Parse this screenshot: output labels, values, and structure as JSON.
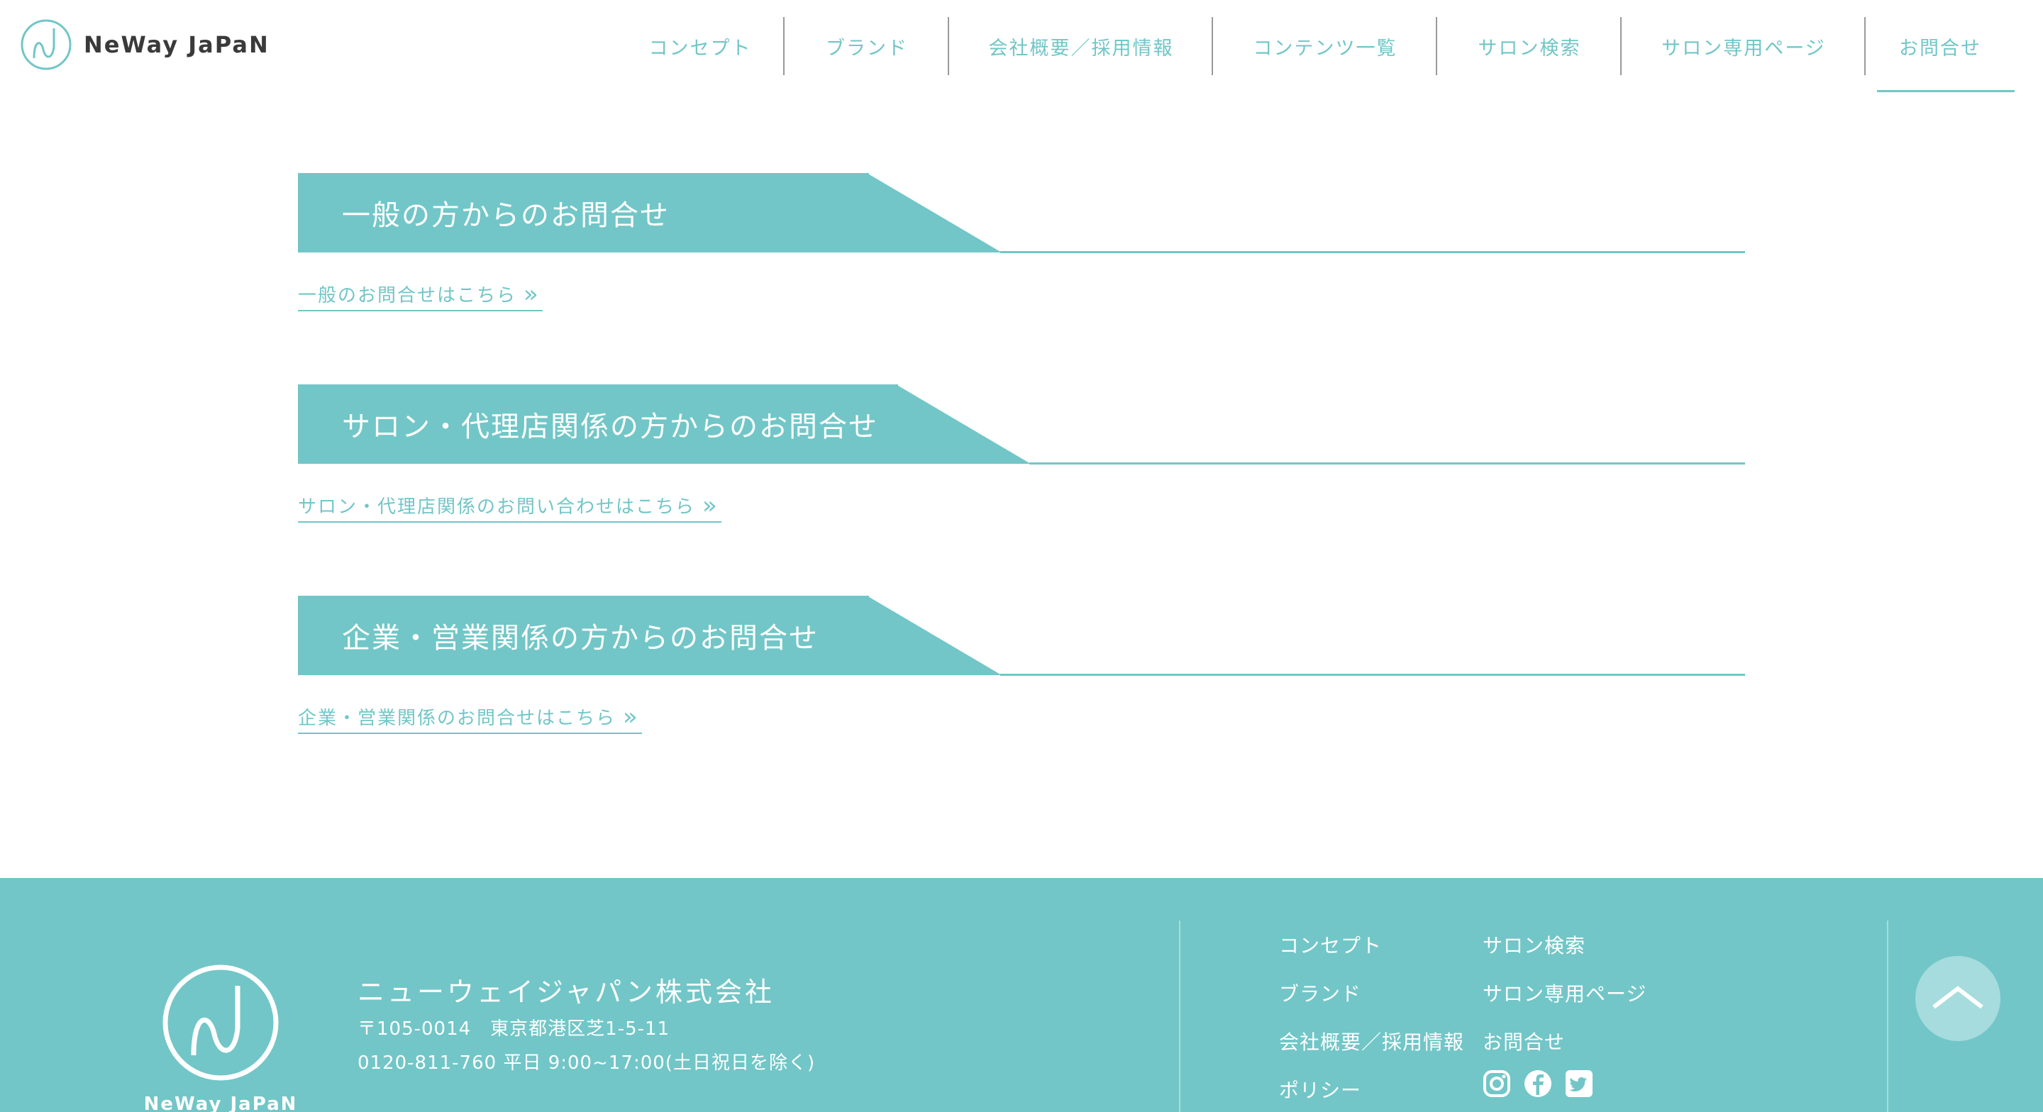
{
  "header": {
    "logo_text": "NeWay JaPaN",
    "nav": [
      {
        "label": "コンセプト"
      },
      {
        "label": "ブランド"
      },
      {
        "label": "会社概要／採用情報"
      },
      {
        "label": "コンテンツ一覧"
      },
      {
        "label": "サロン検索"
      },
      {
        "label": "サロン専用ページ"
      },
      {
        "label": "お問合せ"
      }
    ]
  },
  "sections": [
    {
      "title": "一般の方からのお問合せ",
      "link": "一般のお問合せはこちら"
    },
    {
      "title": "サロン・代理店関係の方からのお問合せ",
      "link": "サロン・代理店関係のお問い合わせはこちら"
    },
    {
      "title": "企業・営業関係の方からのお問合せ",
      "link": "企業・営業関係のお問合せはこちら"
    }
  ],
  "footer": {
    "logo_text": "NeWay JaPaN",
    "company": "ニューウェイジャパン株式会社",
    "address": "〒105-0014　東京都港区芝1-5-11",
    "phone": "0120-811-760 平日 9:00~17:00(土日祝日を除く)",
    "links_col1": [
      "コンセプト",
      "ブランド",
      "会社概要／採用情報",
      "ポリシー"
    ],
    "links_col2": [
      "サロン検索",
      "サロン専用ページ",
      "お問合せ"
    ],
    "social": [
      "instagram-icon",
      "facebook-icon",
      "twitter-icon"
    ]
  },
  "colors": {
    "accent": "#72c6c7",
    "footer_bg": "#72c6c7",
    "to_top_bg": "#a6dcdd"
  }
}
